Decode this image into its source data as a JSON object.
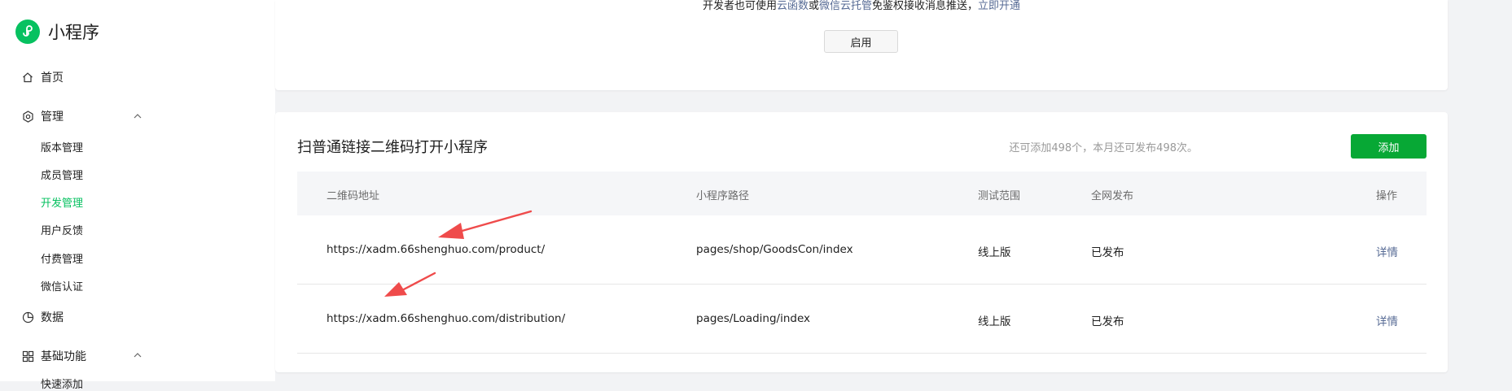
{
  "brand": {
    "title": "小程序"
  },
  "nav": {
    "home": "首页",
    "manage": "管理",
    "manage_items": [
      "版本管理",
      "成员管理",
      "开发管理",
      "用户反馈",
      "付费管理",
      "微信认证"
    ],
    "data": "数据",
    "basic": "基础功能",
    "basic_partial": "快速添加"
  },
  "notice": {
    "prefix": "开发者也可使用",
    "cloud_func": "云函数",
    "or": "或",
    "cloud_host": "微信云托管",
    "suffix": "免鉴权接收消息推送，",
    "open_now": "立即开通"
  },
  "enable_button": "启用",
  "section": {
    "title": "扫普通链接二维码打开小程序",
    "quota": "还可添加498个，本月还可发布498次。",
    "add_button": "添加"
  },
  "table": {
    "headers": [
      "二维码地址",
      "小程序路径",
      "测试范围",
      "全网发布",
      "操作"
    ],
    "rows": [
      [
        "https://xadm.66shenghuo.com/product/",
        "pages/shop/GoodsCon/index",
        "线上版",
        "已发布",
        "详情"
      ],
      [
        "https://xadm.66shenghuo.com/distribution/",
        "pages/Loading/index",
        "线上版",
        "已发布",
        "详情"
      ]
    ]
  },
  "colors": {
    "brand_green": "#07c160",
    "add_green": "#07a835",
    "link_blue": "#576b95",
    "arrow_red": "#ef4b4b"
  }
}
